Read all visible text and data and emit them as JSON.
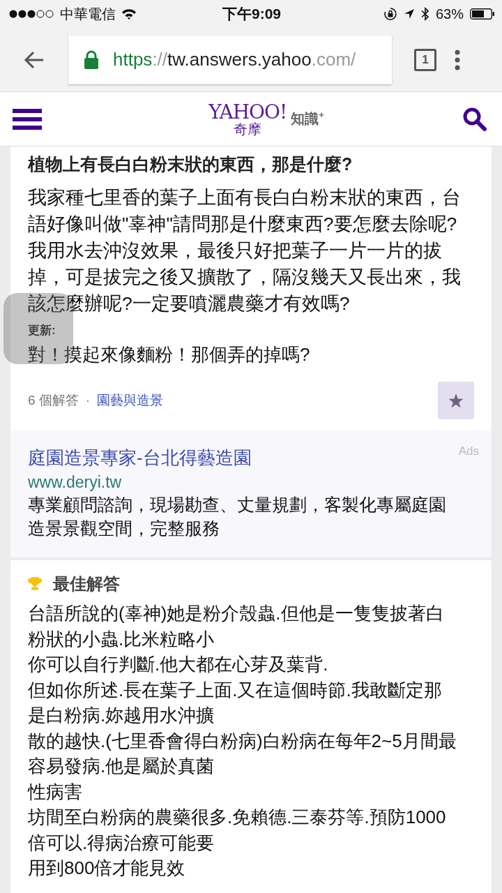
{
  "status_bar": {
    "carrier": "中華電信",
    "time": "下午9:09",
    "battery": "63%"
  },
  "browser": {
    "url_scheme": "https",
    "url_sep": "://",
    "url_host": "tw.answers.yahoo",
    "url_rest": ".com/",
    "tab_count": "1"
  },
  "header": {
    "logo": "YAHOO!",
    "logo_sub": "奇摩",
    "product": "知識$^{+}$"
  },
  "question": {
    "title": "植物上有長白白粉末狀的東西，那是什麼?",
    "body": "我家種七里香的葉子上面有長白白粉末狀的東西，台語好像叫做\"辜神\"請問那是什麼東西?要怎麼去除呢?我用水去沖沒效果，最後只好把葉子一片一片的拔掉，可是拔完之後又擴散了，隔沒幾天又長出來，我該怎麼辦呢?一定要噴灑農藥才有效嗎?",
    "update_label": "更新:",
    "update_text": "對！摸起來像麵粉！那個弄的掉嗎?",
    "answer_count": "6 個解答",
    "separator": "·",
    "category": "園藝與造景"
  },
  "ad": {
    "label": "Ads",
    "title": "庭園造景專家-台北得藝造園",
    "url": "www.deryi.tw",
    "description": "專業顧問諮詢，現場勘查、丈量規劃，客製化專屬庭園造景景觀空間，完整服務"
  },
  "best_answer": {
    "label": "最佳解答",
    "paragraphs": [
      "台語所說的(辜神)她是粉介殼蟲.但他是一隻隻披著白粉狀的小蟲.比米粒略小",
      "你可以自行判斷.他大都在心芽及葉背.",
      "但如你所述.長在葉子上面.又在這個時節.我敢斷定那是白粉病.妳越用水沖擴",
      "散的越快.(七里香會得白粉病)白粉病在每年2~5月間最容易發病.他是屬於真菌",
      "性病害",
      "坊間至白粉病的農藥很多.免賴德.三泰芬等.預防1000倍可以.得病治療可能要",
      "用到800倍才能見效"
    ]
  }
}
